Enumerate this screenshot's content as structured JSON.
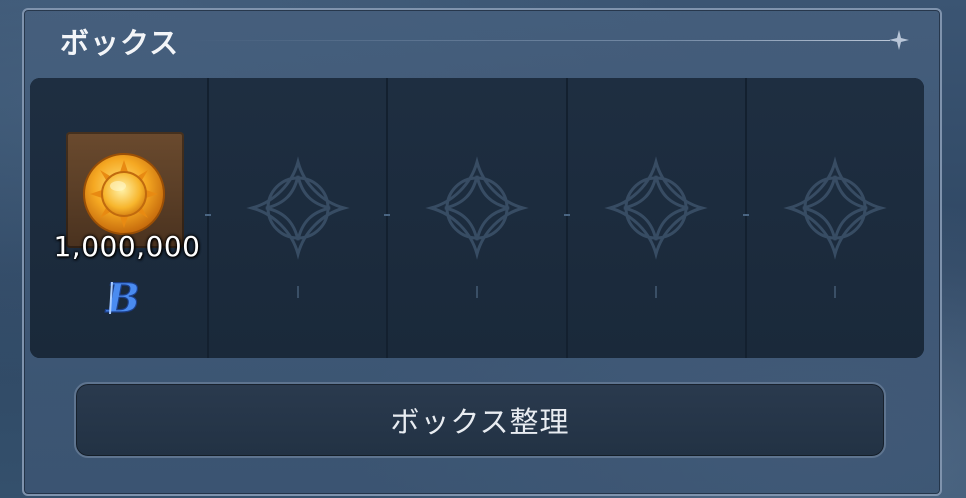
{
  "panel": {
    "title": "ボックス",
    "title_icon": "sparkle-icon"
  },
  "slots": [
    {
      "filled": true,
      "icon": "gold-sun-coin-icon",
      "quantity": "1,000,000",
      "badge_icon": "bound-b-icon",
      "badge_color": "#4a8bf0"
    },
    {
      "filled": false,
      "icon": "empty-slot-emblem-icon"
    },
    {
      "filled": false,
      "icon": "empty-slot-emblem-icon"
    },
    {
      "filled": false,
      "icon": "empty-slot-emblem-icon"
    },
    {
      "filled": false,
      "icon": "empty-slot-emblem-icon"
    }
  ],
  "actions": {
    "organize_label": "ボックス整理"
  },
  "colors": {
    "panel_border": "#7f93ad",
    "slot_bg": "#1b2a3c",
    "coin_gold": "#f2a21b",
    "item_frame": "#5b3f27"
  }
}
